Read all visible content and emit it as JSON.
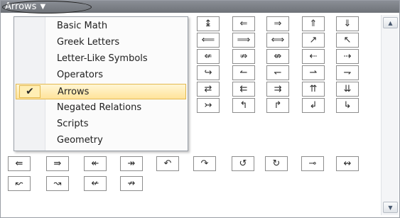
{
  "gallery": {
    "category_label": "Arrows",
    "caret": "▼",
    "symbols": [
      "↨",
      "⇐",
      "⇒",
      "⇑",
      "⇓",
      "⟸",
      "⟹",
      "⟺",
      "↗",
      "↖",
      "⇍",
      "⇏",
      "⇎",
      "⇠",
      "⇢",
      "↪",
      "↼",
      "↽",
      "⇀",
      "⇁",
      "⇄",
      "⇇",
      "⇉",
      "⇈",
      "⇊",
      "↣",
      "↰",
      "↱",
      "↲",
      "↳",
      "⇚",
      "⇛",
      "↞",
      "↠",
      "↶",
      "↷",
      "↺",
      "↻",
      "⊸",
      "↭",
      "↜",
      "↝",
      "↚",
      "↛"
    ]
  },
  "menu": {
    "items": [
      {
        "label": "Basic Math"
      },
      {
        "label": "Greek Letters"
      },
      {
        "label": "Letter-Like Symbols"
      },
      {
        "label": "Operators"
      },
      {
        "label": "Arrows",
        "selected": true
      },
      {
        "label": "Negated Relations"
      },
      {
        "label": "Scripts"
      },
      {
        "label": "Geometry"
      }
    ],
    "check_mark": "✔"
  },
  "scrollbar": {
    "up_arrow": "▲",
    "down_arrow": "▼"
  },
  "colors": {
    "selected_fill": "#ffe39a",
    "selected_border": "#e3b94f",
    "header": "#7a7e85"
  }
}
